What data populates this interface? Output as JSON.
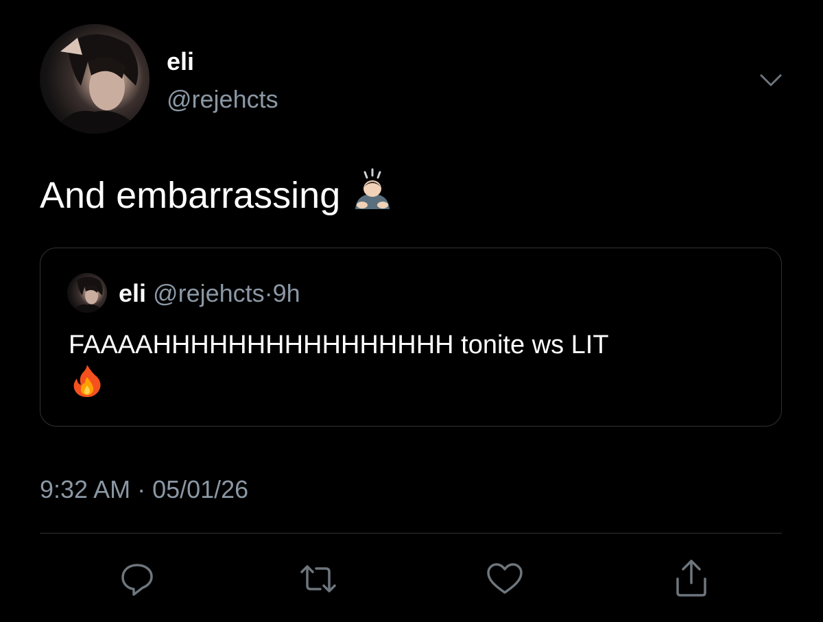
{
  "author": {
    "display_name": "eli",
    "handle": "@rejehcts",
    "avatar": "profile-photo"
  },
  "tweet": {
    "text": "And embarrassing",
    "emoji": "person-bowing-emoji"
  },
  "quoted_tweet": {
    "display_name": "eli",
    "handle": "@rejehcts",
    "separator": "·",
    "relative_time": "9h",
    "text": "FAAAAHHHHHHHHHHHHHHHH tonite ws LIT",
    "emoji": "fire-emoji"
  },
  "meta": {
    "timestamp": "9:32 AM · 05/01/26"
  },
  "actions": {
    "reply": "reply-icon",
    "retweet": "retweet-icon",
    "like": "heart-icon",
    "share": "share-icon"
  },
  "colors": {
    "background": "#000000",
    "text": "#ffffff",
    "secondary_text": "#8b98a5",
    "border": "#2f3336"
  }
}
